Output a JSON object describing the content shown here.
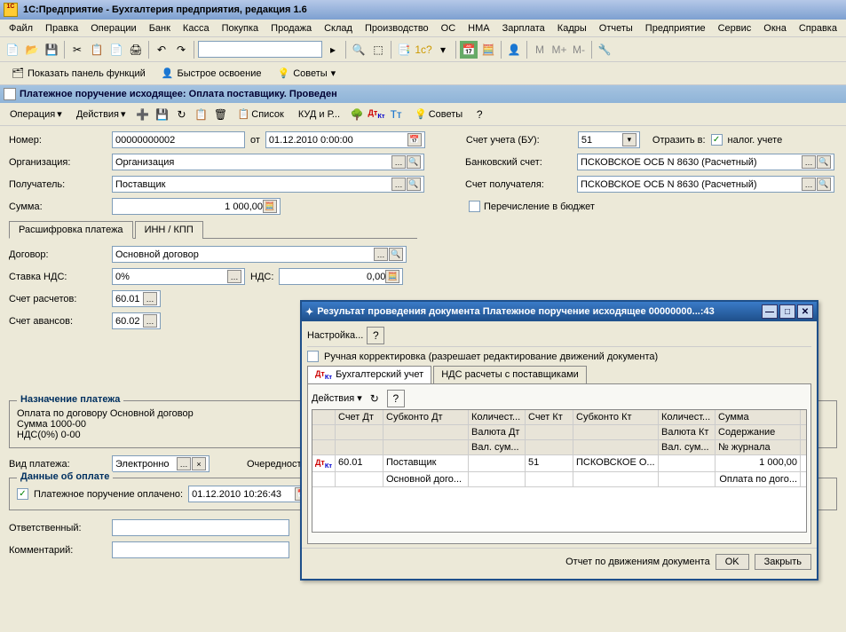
{
  "app": {
    "title": "1С:Предприятие - Бухгалтерия предприятия, редакция 1.6"
  },
  "menu": [
    "Файл",
    "Правка",
    "Операции",
    "Банк",
    "Касса",
    "Покупка",
    "Продажа",
    "Склад",
    "Производство",
    "ОС",
    "НМА",
    "Зарплата",
    "Кадры",
    "Отчеты",
    "Предприятие",
    "Сервис",
    "Окна",
    "Справка"
  ],
  "toolbar2": {
    "panel": "Показать панель функций",
    "quick": "Быстрое освоение",
    "tips": "Советы"
  },
  "doc": {
    "title": "Платежное поручение исходящее: Оплата поставщику. Проведен"
  },
  "doctb": {
    "op": "Операция",
    "act": "Действия",
    "list": "Список",
    "kud": "КУД и Р...",
    "tips": "Советы"
  },
  "form": {
    "num_lbl": "Номер:",
    "num": "00000000002",
    "ot": "от",
    "date": "01.12.2010 0:00:00",
    "org_lbl": "Организация:",
    "org": "Организация",
    "rcv_lbl": "Получатель:",
    "rcv": "Поставщик",
    "sum_lbl": "Сумма:",
    "sum": "1 000,00",
    "acct_lbl": "Счет учета (БУ):",
    "acct": "51",
    "refl": "Отразить в:",
    "nalog": "налог. учете",
    "bank_lbl": "Банковский счет:",
    "bank": "ПСКОВСКОЕ ОСБ N 8630 (Расчетный)",
    "racct_lbl": "Счет получателя:",
    "racct": "ПСКОВСКОЕ ОСБ N 8630 (Расчетный)",
    "budget": "Перечисление в бюджет"
  },
  "tabs": {
    "t1": "Расшифровка платежа",
    "t2": "ИНН / КПП"
  },
  "detail": {
    "dog_lbl": "Договор:",
    "dog": "Основной договор",
    "nds_lbl": "Ставка НДС:",
    "nds_rate": "0%",
    "nds2": "НДС:",
    "nds_val": "0,00",
    "sr_lbl": "Счет расчетов:",
    "sr": "60.01",
    "sa_lbl": "Счет авансов:",
    "sa": "60.02",
    "purpose_title": "Назначение платежа",
    "purpose": "Оплата по договору Основной договор\nСумма 1000-00\nНДС(0%) 0-00",
    "pl1": "Оплата по договору Основной договор",
    "pl2": "Сумма 1000-00",
    "pl3": "НДС(0%) 0-00",
    "vid_lbl": "Вид платежа:",
    "vid": "Электронно",
    "queue_lbl": "Очередность:",
    "pay_group": "Данные об оплате",
    "paid_lbl": "Платежное поручение оплачено:",
    "paid_date": "01.12.2010 10:26:43",
    "resp_lbl": "Ответственный:",
    "comm_lbl": "Комментарий:"
  },
  "dlg": {
    "title": "Результат проведения документа Платежное поручение исходящее 00000000...:43",
    "settings": "Настройка...",
    "manual": "Ручная корректировка (разрешает редактирование движений документа)",
    "tab1": "Бухгалтерский учет",
    "tab2": "НДС расчеты с поставщиками",
    "act": "Действия",
    "hdr": {
      "c1": "Счет Дт",
      "c2": "Субконто Дт",
      "c3": "Количест...",
      "c4": "Счет Кт",
      "c5": "Субконто Кт",
      "c6": "Количест...",
      "c7": "Сумма",
      "c3b": "Валюта Дт",
      "c6b": "Валюта Кт",
      "c7b": "Содержание",
      "c3c": "Вал. сум...",
      "c6c": "Вал. сум...",
      "c7c": "№ журнала"
    },
    "row": {
      "dt": "60.01",
      "sub1": "Поставщик",
      "sub1b": "Основной дого...",
      "kt": "51",
      "sub2": "ПСКОВСКОЕ О...",
      "sum": "1 000,00",
      "sum2": "Оплата по дого..."
    },
    "report": "Отчет по движениям документа",
    "ok": "OK",
    "close": "Закрыть"
  }
}
